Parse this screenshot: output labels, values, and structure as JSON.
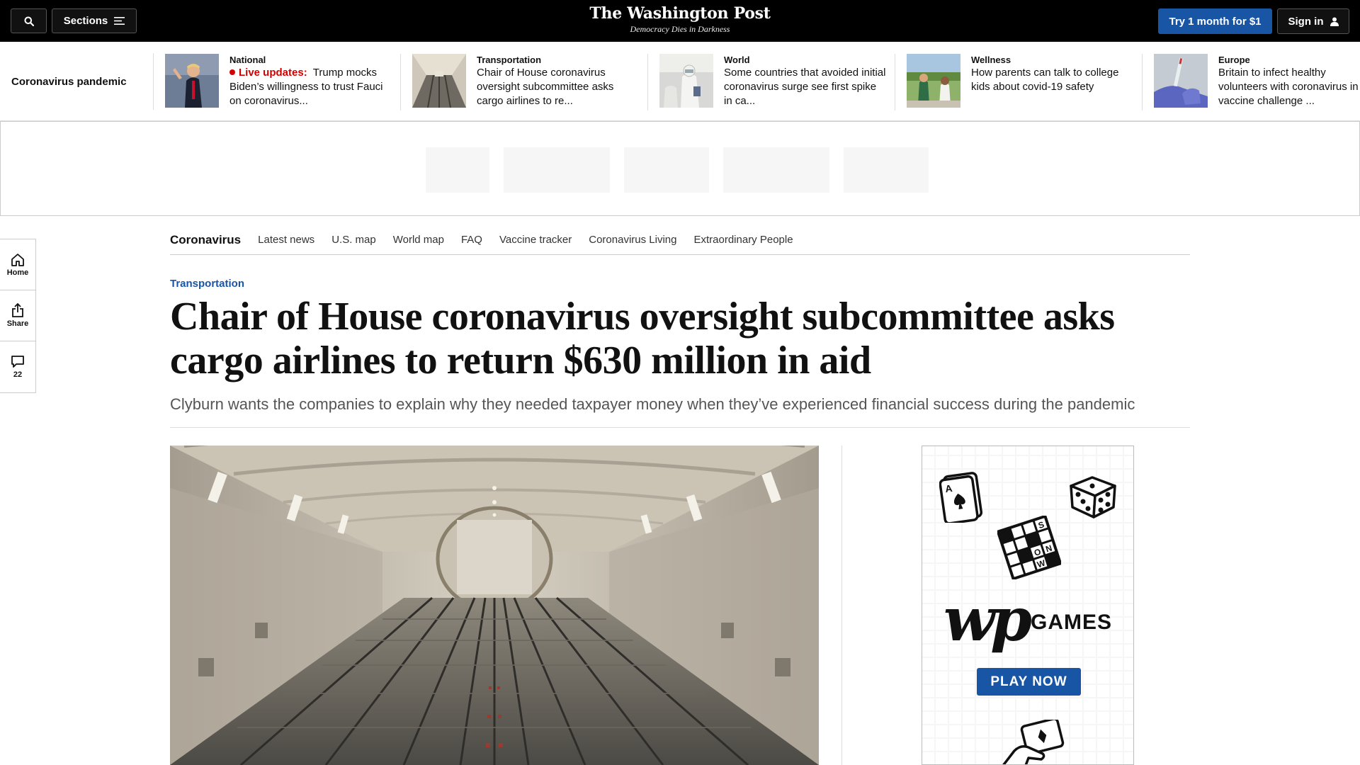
{
  "topbar": {
    "sections_label": "Sections",
    "logo_name": "The Washington Post",
    "logo_tagline": "Democracy Dies in Darkness",
    "subscribe_label": "Try 1 month for $1",
    "signin_label": "Sign in"
  },
  "strip": {
    "label": "Coronavirus pandemic",
    "items": [
      {
        "kicker": "National",
        "live_label": "Live updates:",
        "headline": "Trump mocks Biden’s willingness to trust Fauci on coronavirus..."
      },
      {
        "kicker": "Transportation",
        "headline": "Chair of House coronavirus oversight subcommittee asks cargo airlines to re..."
      },
      {
        "kicker": "World",
        "headline": "Some countries that avoided initial coronavirus surge see first spike in ca..."
      },
      {
        "kicker": "Wellness",
        "headline": "How parents can talk to college kids about covid-19 safety"
      },
      {
        "kicker": "Europe",
        "headline": "Britain to infect healthy volunteers with coronavirus in vaccine challenge ..."
      }
    ]
  },
  "subnav": {
    "brand": "Coronavirus",
    "links": [
      "Latest news",
      "U.S. map",
      "World map",
      "FAQ",
      "Vaccine tracker",
      "Coronavirus Living",
      "Extraordinary People"
    ]
  },
  "rail": {
    "home_label": "Home",
    "share_label": "Share",
    "comments_count": "22"
  },
  "article": {
    "section": "Transportation",
    "headline": "Chair of House coronavirus oversight subcommittee asks cargo airlines to return $630 million in aid",
    "subhead": "Clyburn wants the companies to explain why they needed taxpayer money when they’ve experienced financial success during the pandemic"
  },
  "games_ad": {
    "logo_text": "wp",
    "games_label": "GAMES",
    "play_label": "PLAY NOW",
    "card_rank": "A",
    "crossword_letters": [
      "S",
      "O",
      "N",
      "W"
    ]
  },
  "colors": {
    "brand_blue": "#1955a5",
    "live_red": "#d20000",
    "topbar_bg": "#000000"
  },
  "icons": [
    "search-icon",
    "menu-icon",
    "user-icon",
    "home-icon",
    "share-icon",
    "comment-icon",
    "playing-card-icon",
    "dice-icon",
    "crossword-icon",
    "hand-card-icon"
  ]
}
